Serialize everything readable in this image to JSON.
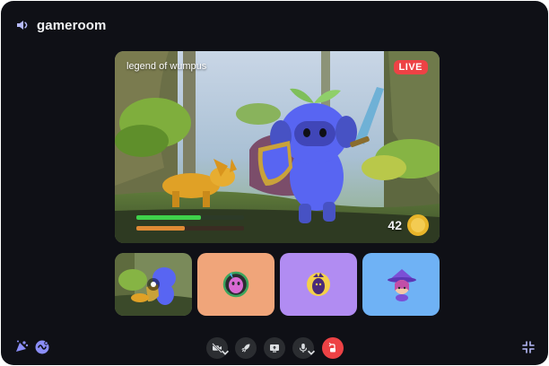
{
  "window": {
    "channel_name": "gameroom",
    "channel_icon": "volume-icon"
  },
  "stream": {
    "title": "legend of wumpus",
    "live_label": "LIVE",
    "hud_counter": "42",
    "health_fraction": 0.6,
    "stamina_fraction": 0.45
  },
  "participants": [
    {
      "kind": "stream-preview"
    },
    {
      "kind": "avatar",
      "tile_color": "#f0a57a",
      "icon": "avatar-green-ring"
    },
    {
      "kind": "avatar",
      "tile_color": "#b18cf2",
      "icon": "avatar-yellow-ring"
    },
    {
      "kind": "avatar",
      "tile_color": "#6fb2f5",
      "icon": "avatar-witch"
    }
  ],
  "controls": {
    "left": [
      "activities-icon",
      "soundboard-icon"
    ],
    "center": [
      "camera-off-icon",
      "rocket-icon",
      "screen-share-icon",
      "microphone-icon",
      "end-call-icon"
    ],
    "right": [
      "collapse-icon"
    ]
  },
  "colors": {
    "background": "#0f1016",
    "button": "#2b2d31",
    "live": "#ed4245",
    "end_call": "#ed4245",
    "accent": "#8b8ef9"
  }
}
